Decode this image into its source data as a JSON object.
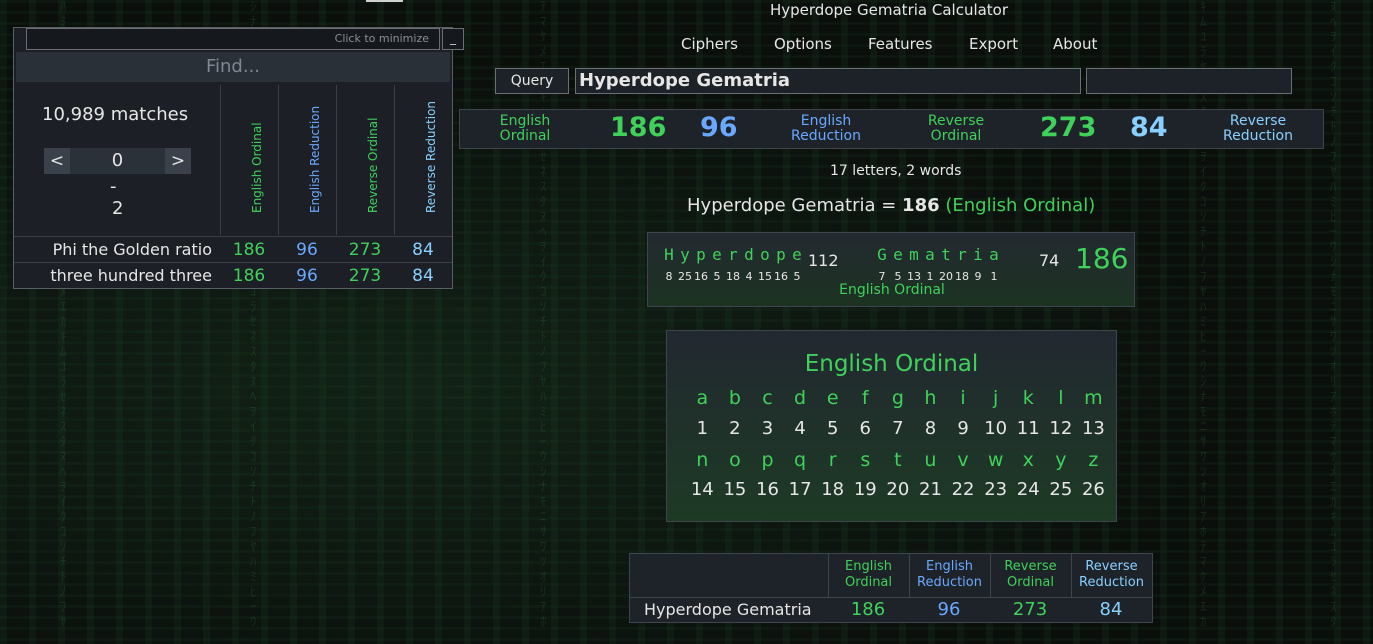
{
  "window": {
    "title": "Hyperdope Gematria Calculator"
  },
  "nav": [
    "Ciphers",
    "Options",
    "Features",
    "Export",
    "About"
  ],
  "query": {
    "button": "Query",
    "value": "Hyperdope Gematria",
    "secondary_value": ""
  },
  "colors": {
    "english_ordinal": "#3fd15a",
    "english_reduction": "#6aa8ff",
    "reverse_ordinal": "#45d6c0",
    "reverse_reduction": "#8ad0ff"
  },
  "summary": [
    {
      "label": "English Ordinal",
      "value": "186"
    },
    {
      "label": "English Reduction",
      "value": "96"
    },
    {
      "label": "Reverse Ordinal",
      "value": "273"
    },
    {
      "label": "Reverse Reduction",
      "value": "84"
    }
  ],
  "letters_words": "17 letters, 2 words",
  "equation": {
    "phrase": "Hyperdope Gematria",
    "eq": " = ",
    "value": "186",
    "cipher": "(English Ordinal)"
  },
  "breakdown": {
    "words": [
      {
        "letters": [
          "H",
          "y",
          "p",
          "e",
          "r",
          "d",
          "o",
          "p",
          "e"
        ],
        "values": [
          "8",
          "25",
          "16",
          "5",
          "18",
          "4",
          "15",
          "16",
          "5"
        ],
        "total": "112"
      },
      {
        "letters": [
          "G",
          "e",
          "m",
          "a",
          "t",
          "r",
          "i",
          "a"
        ],
        "values": [
          "7",
          "5",
          "13",
          "1",
          "20",
          "18",
          "9",
          "1"
        ],
        "total": "74"
      }
    ],
    "total": "186",
    "cipher": "English Ordinal"
  },
  "cipher_chart": {
    "title": "English Ordinal",
    "rows": [
      {
        "letters": [
          "a",
          "b",
          "c",
          "d",
          "e",
          "f",
          "g",
          "h",
          "i",
          "j",
          "k",
          "l",
          "m"
        ],
        "values": [
          "1",
          "2",
          "3",
          "4",
          "5",
          "6",
          "7",
          "8",
          "9",
          "10",
          "11",
          "12",
          "13"
        ]
      },
      {
        "letters": [
          "n",
          "o",
          "p",
          "q",
          "r",
          "s",
          "t",
          "u",
          "v",
          "w",
          "x",
          "y",
          "z"
        ],
        "values": [
          "14",
          "15",
          "16",
          "17",
          "18",
          "19",
          "20",
          "21",
          "22",
          "23",
          "24",
          "25",
          "26"
        ]
      }
    ]
  },
  "results_table": {
    "headers": [
      "English Ordinal",
      "English Reduction",
      "Reverse Ordinal",
      "Reverse Reduction"
    ],
    "row": {
      "label": "Hyperdope Gematria",
      "values": [
        "186",
        "96",
        "273",
        "84"
      ]
    }
  },
  "find_panel": {
    "minimize_hint": "Click to minimize",
    "minimize_button": "_",
    "placeholder": "Find...",
    "matches": "10,989 matches",
    "pager": {
      "prev": "<",
      "value": "0",
      "next": ">"
    },
    "range_sep": "-",
    "range_end": "2",
    "columns": [
      "English Ordinal",
      "English Reduction",
      "Reverse Ordinal",
      "Reverse Reduction"
    ],
    "rows": [
      {
        "label": "Phi the Golden ratio",
        "values": [
          "186",
          "96",
          "273",
          "84"
        ]
      },
      {
        "label": "three hundred three",
        "values": [
          "186",
          "96",
          "273",
          "84"
        ]
      }
    ]
  }
}
